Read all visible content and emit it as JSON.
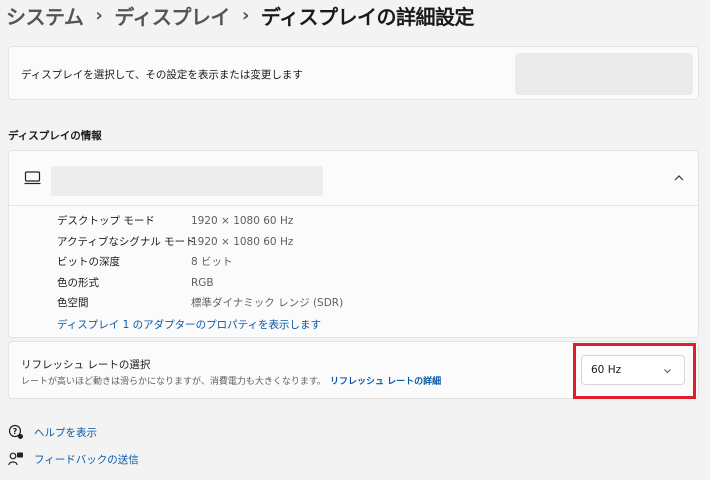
{
  "breadcrumb": {
    "items": [
      "システム",
      "ディスプレイ",
      "ディスプレイの詳細設定"
    ],
    "separator": "›"
  },
  "select_display": {
    "description": "ディスプレイを選択して、その設定を表示または変更します"
  },
  "display_info": {
    "section_title": "ディスプレイの情報",
    "rows": [
      {
        "label": "デスクトップ モード",
        "value": "1920 × 1080 60 Hz"
      },
      {
        "label": "アクティブなシグナル モード",
        "value": "1920 × 1080 60 Hz"
      },
      {
        "label": "ビットの深度",
        "value": "8 ビット"
      },
      {
        "label": "色の形式",
        "value": "RGB"
      },
      {
        "label": "色空間",
        "value": "標準ダイナミック レンジ (SDR)"
      }
    ],
    "adapter_link": "ディスプレイ 1 のアダプターのプロパティを表示します"
  },
  "refresh_rate": {
    "title": "リフレッシュ レートの選択",
    "description": "レートが高いほど動きは滑らかになりますが、消費電力も大きくなります。",
    "details_link": "リフレッシュ レートの詳細",
    "selected": "60 Hz"
  },
  "footer": {
    "help_label": "ヘルプを表示",
    "feedback_label": "フィードバックの送信"
  },
  "colors": {
    "accent_link": "#0a59a8",
    "highlight_border": "#e01e2b",
    "background": "#f3f3f3"
  },
  "icons": [
    "monitor-icon",
    "chevron-up-icon",
    "chevron-down-icon",
    "help-icon",
    "feedback-icon"
  ]
}
